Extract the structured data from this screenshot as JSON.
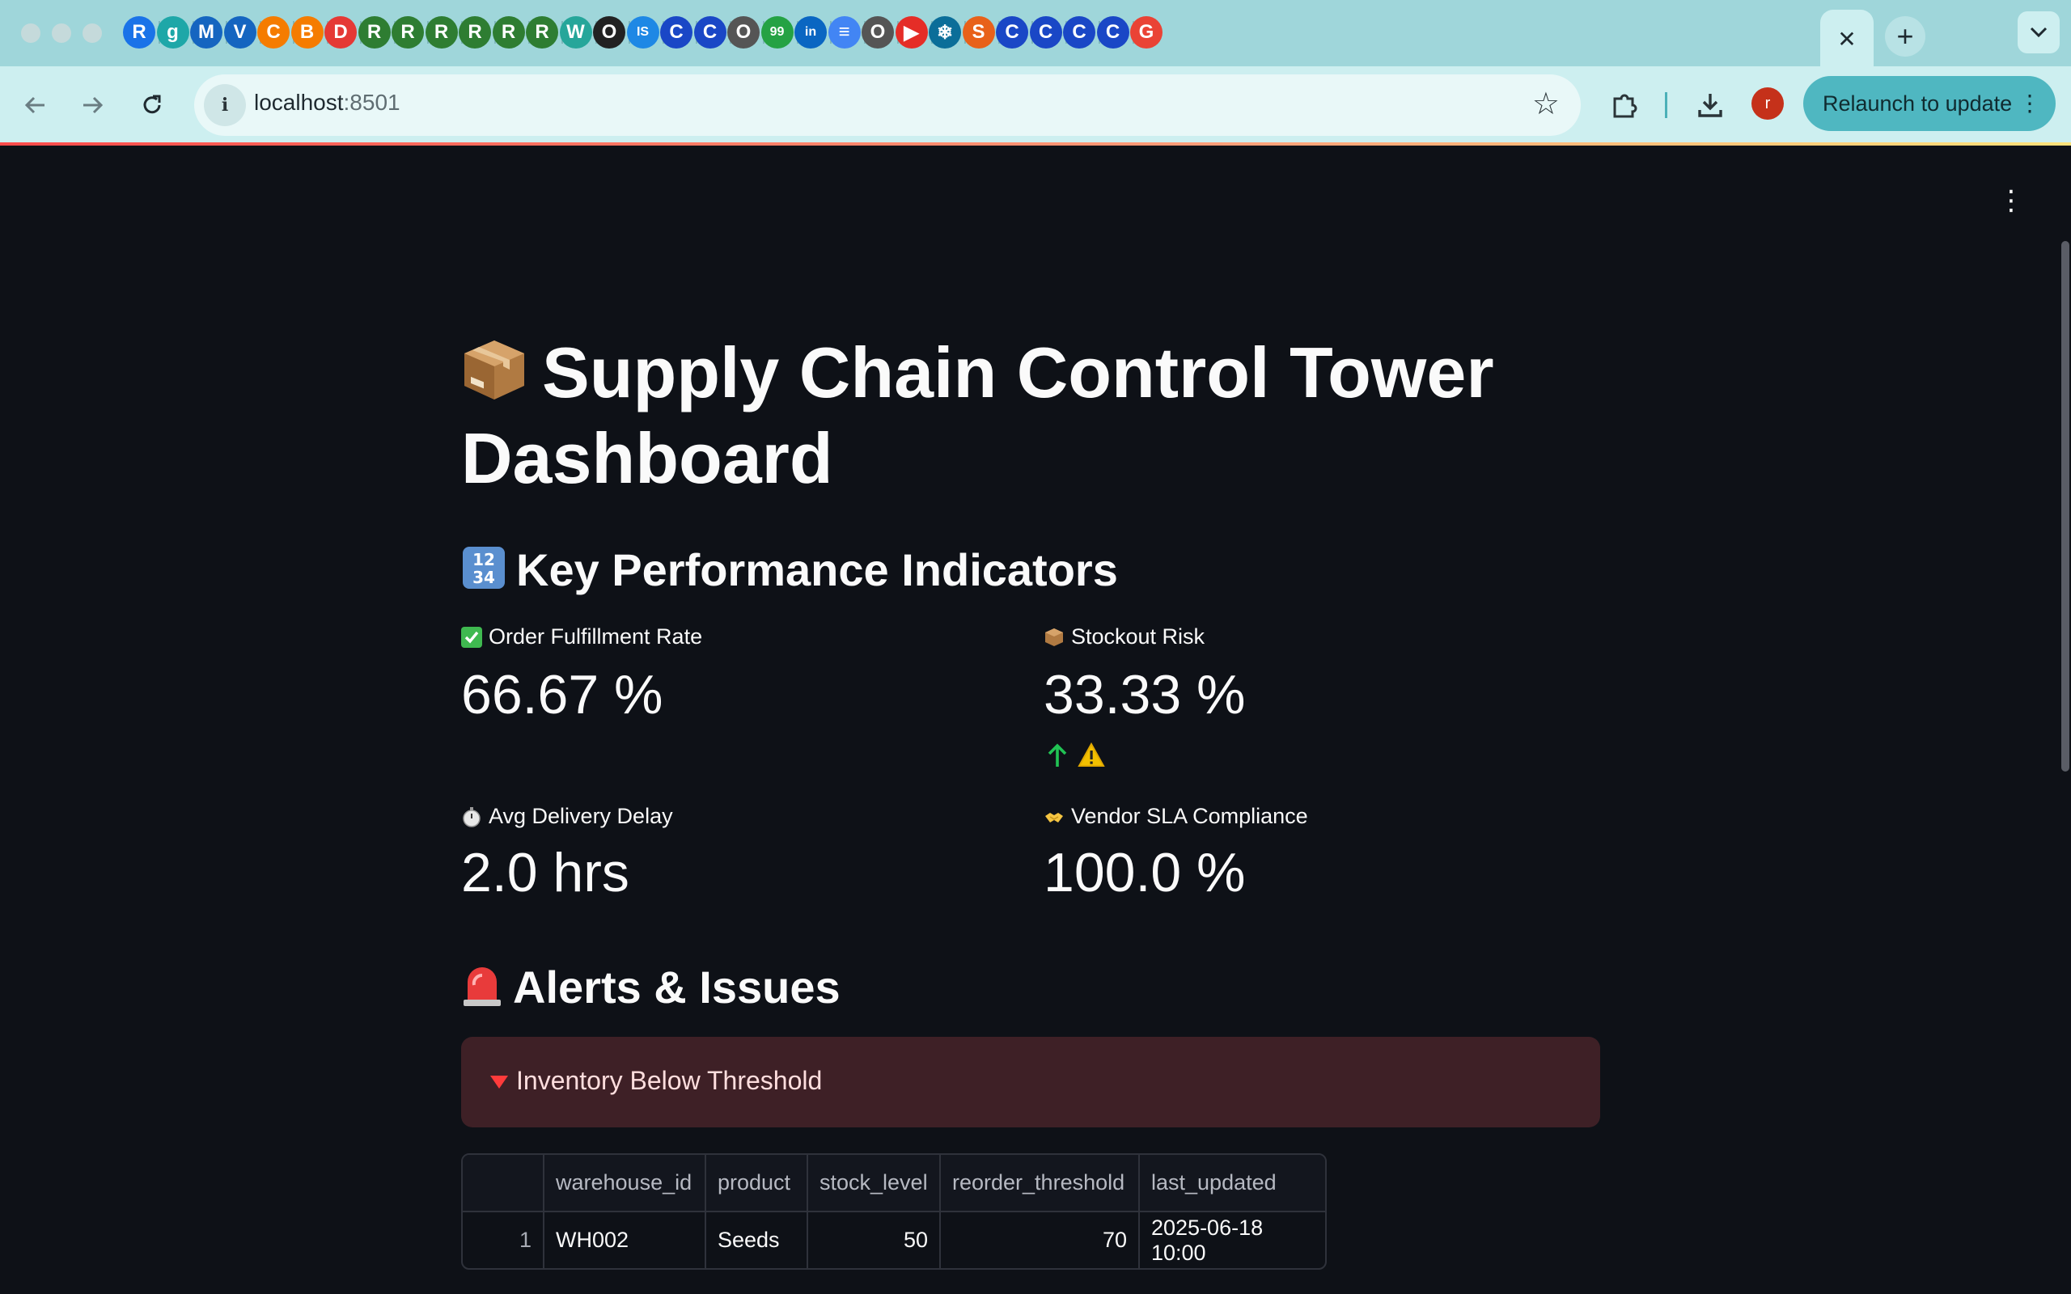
{
  "browser": {
    "tab_favicons": [
      "R",
      "g",
      "M",
      "V",
      "C",
      "B",
      "D",
      "R",
      "R",
      "R",
      "R",
      "R",
      "R",
      "W",
      "O",
      "IS",
      "C",
      "C",
      "O",
      "99",
      "in",
      "≡",
      "O",
      "▶",
      "❄",
      "S",
      "C",
      "C",
      "C",
      "C",
      "G"
    ],
    "active_tab_close": "✕",
    "new_tab": "+",
    "tab_menu": "⌄",
    "url_host": "localhost",
    "url_port": ":8501",
    "profile_initial": "r",
    "relaunch_label": "Relaunch to update"
  },
  "page": {
    "title": "Supply Chain Control Tower Dashboard",
    "kpi_heading": "Key Performance Indicators",
    "alerts_heading": "Alerts & Issues"
  },
  "metrics": [
    {
      "label": "Order Fulfillment Rate",
      "value": "66.67 %",
      "icon": "check-mark-icon"
    },
    {
      "label": "Stockout Risk",
      "value": "33.33 %",
      "icon": "package-icon",
      "delta": "⚠️"
    },
    {
      "label": "Avg Delivery Delay",
      "value": "2.0 hrs",
      "icon": "stopwatch-icon"
    },
    {
      "label": "Vendor SLA Compliance",
      "value": "100.0 %",
      "icon": "handshake-icon"
    }
  ],
  "alert": {
    "label": "Inventory Below Threshold"
  },
  "table": {
    "columns": [
      "",
      "warehouse_id",
      "product",
      "stock_level",
      "reorder_threshold",
      "last_updated"
    ],
    "rows": [
      {
        "index": "1",
        "warehouse_id": "WH002",
        "product": "Seeds",
        "stock_level": "50",
        "reorder_threshold": "70",
        "last_updated": "2025-06-18 10:00"
      }
    ]
  },
  "colors": {
    "background": "#0e1117",
    "alert_bg": "#3e2026",
    "delta_up": "#21c354",
    "chrome": "#cdeff0"
  }
}
